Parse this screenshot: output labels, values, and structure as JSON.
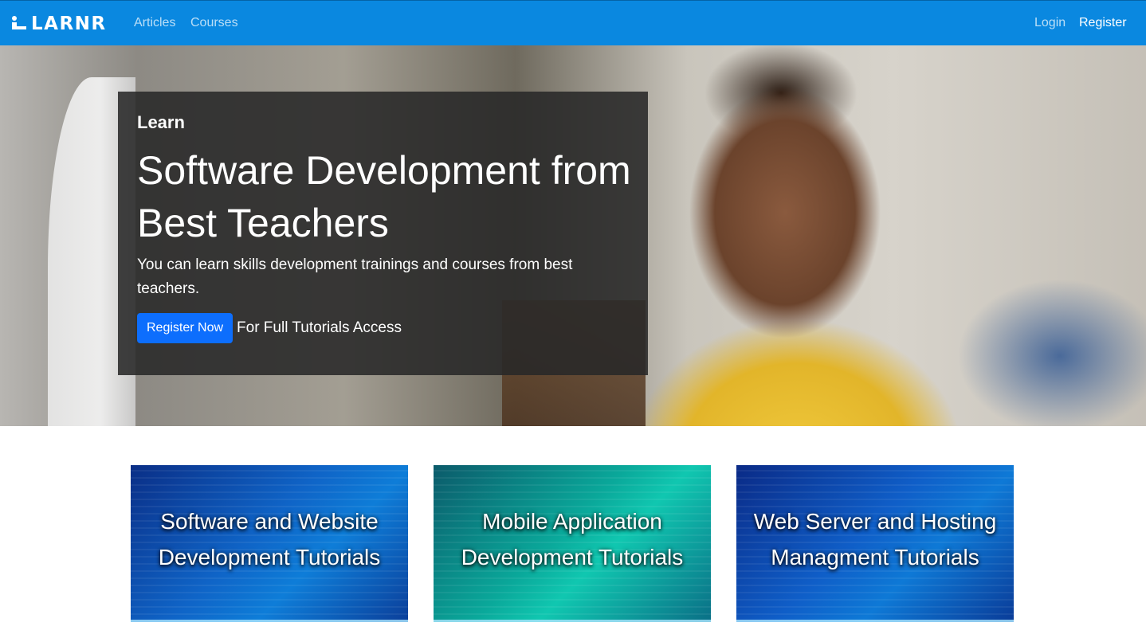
{
  "nav": {
    "brand": "LARNR",
    "links": {
      "articles": "Articles",
      "courses": "Courses"
    },
    "auth": {
      "login": "Login",
      "register": "Register"
    }
  },
  "hero": {
    "eyebrow": "Learn",
    "title": "Software Development from Best Teachers",
    "text": "You can learn skills development trainings and courses from best teachers.",
    "cta_button": "Register Now",
    "cta_note": "For Full Tutorials Access"
  },
  "cards": [
    {
      "title": "Software and Website Development Tutorials"
    },
    {
      "title": "Mobile Application Development Tutorials"
    },
    {
      "title": "Web Server and Hosting Managment Tutorials"
    }
  ],
  "colors": {
    "navbar": "#0a88e0",
    "button": "#0d6efd"
  }
}
